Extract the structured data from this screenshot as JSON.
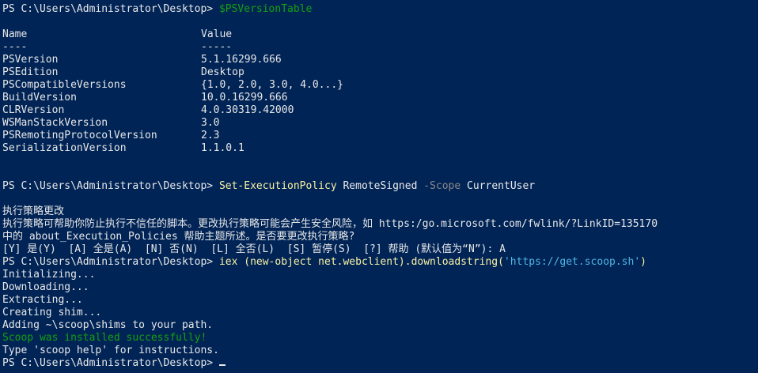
{
  "prompt": "PS C:\\Users\\Administrator\\Desktop> ",
  "cmd1": {
    "text": "$PSVersionTable"
  },
  "table": {
    "headers": [
      "Name",
      "Value"
    ],
    "separators": [
      "----",
      "-----"
    ],
    "rows": [
      {
        "name": "PSVersion",
        "value": "5.1.16299.666"
      },
      {
        "name": "PSEdition",
        "value": "Desktop"
      },
      {
        "name": "PSCompatibleVersions",
        "value": "{1.0, 2.0, 3.0, 4.0...}"
      },
      {
        "name": "BuildVersion",
        "value": "10.0.16299.666"
      },
      {
        "name": "CLRVersion",
        "value": "4.0.30319.42000"
      },
      {
        "name": "WSManStackVersion",
        "value": "3.0"
      },
      {
        "name": "PSRemotingProtocolVersion",
        "value": "2.3"
      },
      {
        "name": "SerializationVersion",
        "value": "1.1.0.1"
      }
    ]
  },
  "cmd2": {
    "cmdlet": "Set-ExecutionPolicy",
    "arg1": " RemoteSigned ",
    "param": "-Scope",
    "arg2": " CurrentUser"
  },
  "policy_msg": {
    "title": "执行策略更改",
    "line1": "执行策略可帮助你防止执行不信任的脚本。更改执行策略可能会产生安全风险，如 https:/go.microsoft.com/fwlink/?LinkID=135170",
    "line2": "中的 about_Execution_Policies 帮助主题所述。是否要更改执行策略?",
    "choices": "[Y] 是(Y)  [A] 全是(A)  [N] 否(N)  [L] 全否(L)  [S] 暂停(S)  [?] 帮助 (默认值为“N”): A"
  },
  "cmd3": {
    "p1": "iex (new-object net.webclient).downloadstring(",
    "str": "'https://get.scoop.sh'",
    "p2": ")"
  },
  "output": {
    "initializing": "Initializing...",
    "downloading": "Downloading...",
    "extracting": "Extracting...",
    "creating_shim": "Creating shim...",
    "adding": "Adding ~\\scoop\\shims to your path.",
    "success": "Scoop was installed successfully!",
    "help": "Type 'scoop help' for instructions."
  },
  "colors": {
    "background": "#012456",
    "text": "#e8e8e8",
    "variable": "#13a10e",
    "command": "#f9f1a5",
    "parameter": "#8a8a8a",
    "string": "#4fb5e5",
    "success": "#13a10e"
  }
}
